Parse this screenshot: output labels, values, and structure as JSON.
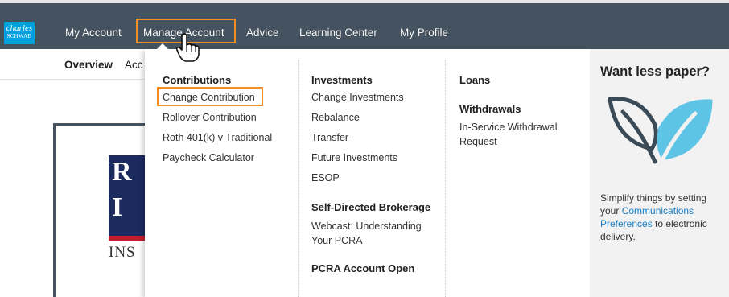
{
  "brand": {
    "line1": "charles",
    "line2": "SCHWAB"
  },
  "nav": {
    "items": [
      {
        "label": "My Account"
      },
      {
        "label": "Manage Account"
      },
      {
        "label": "Advice"
      },
      {
        "label": "Learning Center"
      },
      {
        "label": "My Profile"
      }
    ]
  },
  "subnav": {
    "items": [
      {
        "label": "Overview"
      },
      {
        "label": "Acc"
      }
    ]
  },
  "seal": {
    "letter_top": "R",
    "letter_bottom": "I",
    "text": "INS"
  },
  "menu": {
    "col1": {
      "heading": "Contributions",
      "links": [
        "Change Contribution",
        "Rollover Contribution",
        "Roth 401(k) v Traditional",
        "Paycheck Calculator"
      ]
    },
    "col2": {
      "heading": "Investments",
      "links": [
        "Change Investments",
        "Rebalance",
        "Transfer",
        "Future Investments",
        "ESOP"
      ],
      "sdb_heading": "Self-Directed Brokerage",
      "sdb_link_line1": "Webcast: Understanding",
      "sdb_link_line2": "Your PCRA",
      "pcra_heading": "PCRA Account Open"
    },
    "col3": {
      "loans_heading": "Loans",
      "withdrawals_heading": "Withdrawals",
      "withdrawal_line1": "In-Service Withdrawal",
      "withdrawal_line2": "Request"
    }
  },
  "promo": {
    "title": "Want less paper?",
    "text_prefix": "Simplify things by setting your ",
    "link_text": "Communications Preferences",
    "text_suffix": " to electronic delivery."
  },
  "colors": {
    "nav_bg": "#44535f",
    "highlight": "#f28e22",
    "logo_bg": "#00a0df",
    "link": "#1d7ec4",
    "leaf_light": "#5ec4e6",
    "leaf_dark": "#3a4a56"
  },
  "icons": {
    "logo": "charles-schwab-logo",
    "leaf": "leaf-icon",
    "cursor": "hand-cursor-icon"
  }
}
